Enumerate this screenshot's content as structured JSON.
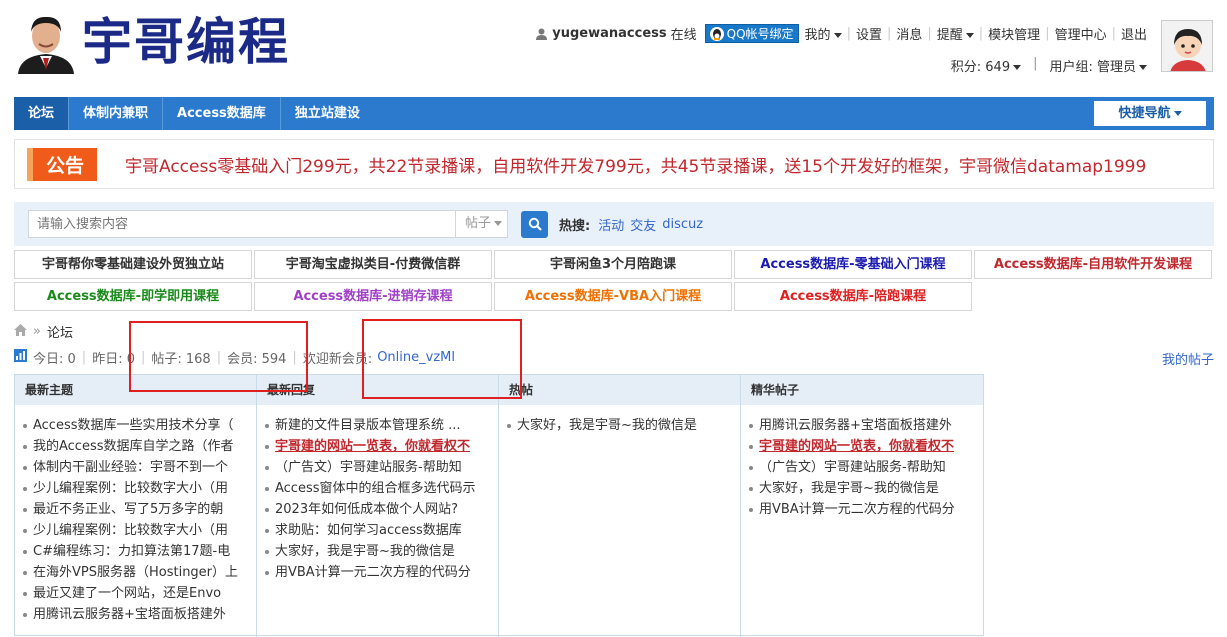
{
  "header": {
    "logo_text": "宇哥编程",
    "username": "yugewanaccess",
    "online": "在线",
    "qq_bind": "QQ帐号绑定",
    "menu": [
      "我的",
      "设置",
      "消息",
      "提醒",
      "模块管理",
      "管理中心",
      "退出"
    ],
    "credits": "积分: 649",
    "usergroup": "用户组: 管理员"
  },
  "nav": {
    "items": [
      "论坛",
      "体制内兼职",
      "Access数据库",
      "独立站建设"
    ],
    "quick_nav": "快捷导航"
  },
  "notice": {
    "badge": "公告",
    "text": "宇哥Access零基础入门299元，共22节录播课，自用软件开发799元，共45节录播课，送15个开发好的框架，宇哥微信datamap1999"
  },
  "search": {
    "placeholder": "请输入搜索内容",
    "type": "帖子",
    "hot_label": "热搜:",
    "hot": [
      "活动",
      "交友",
      "discuz"
    ]
  },
  "links": [
    {
      "label": "宇哥帮你零基础建设外贸独立站",
      "color": "#333333"
    },
    {
      "label": "宇哥淘宝虚拟类目-付费微信群",
      "color": "#333333"
    },
    {
      "label": "宇哥闲鱼3个月陪跑课",
      "color": "#333333"
    },
    {
      "label": "Access数据库-零基础入门课程",
      "color": "#1b1bb0"
    },
    {
      "label": "Access数据库-自用软件开发课程",
      "color": "#c1272d"
    },
    {
      "label": "Access数据库-即学即用课程",
      "color": "#1a8a1a"
    },
    {
      "label": "Access数据库-进销存课程",
      "color": "#a040c8"
    },
    {
      "label": "Access数据库-VBA入门课程",
      "color": "#f07000"
    },
    {
      "label": "Access数据库-陪跑课程",
      "color": "#e02020"
    }
  ],
  "breadcrumb": {
    "sep": "»",
    "current": "论坛"
  },
  "stats": {
    "today": "今日: 0",
    "yesterday": "昨日: 0",
    "posts": "帖子: 168",
    "members": "会员: 594",
    "welcome": "欢迎新会员:",
    "new_member": "Online_vzMl",
    "my_posts": "我的帖子"
  },
  "columns": [
    {
      "title": "最新主题",
      "items": [
        {
          "text": "Access数据库一些实用技术分享（"
        },
        {
          "text": "我的Access数据库自学之路（作者"
        },
        {
          "text": "体制内干副业经验：宇哥不到一个"
        },
        {
          "text": "少儿编程案例：比较数字大小（用"
        },
        {
          "text": "最近不务正业、写了5万多字的朝"
        },
        {
          "text": "少儿编程案例：比较数字大小（用"
        },
        {
          "text": "C#编程练习：力扣算法第17题-电"
        },
        {
          "text": "在海外VPS服务器（Hostinger）上"
        },
        {
          "text": "最近又建了一个网站，还是Envo"
        },
        {
          "text": "用腾讯云服务器+宝塔面板搭建外"
        }
      ]
    },
    {
      "title": "最新回复",
      "items": [
        {
          "text": "新建的文件目录版本管理系统 ..."
        },
        {
          "text": "宇哥建的网站一览表，你就看权不",
          "hl": true
        },
        {
          "text": "（广告文）宇哥建站服务-帮助知"
        },
        {
          "text": "Access窗体中的组合框多选代码示"
        },
        {
          "text": "2023年如何低成本做个人网站?"
        },
        {
          "text": "求助贴：如何学习access数据库"
        },
        {
          "text": "大家好，我是宇哥~我的微信是"
        },
        {
          "text": "用VBA计算一元二次方程的代码分"
        }
      ]
    },
    {
      "title": "热帖",
      "items": [
        {
          "text": "大家好，我是宇哥~我的微信是"
        }
      ]
    },
    {
      "title": "精华帖子",
      "items": [
        {
          "text": "用腾讯云服务器+宝塔面板搭建外"
        },
        {
          "text": "宇哥建的网站一览表，你就看权不",
          "hl": true
        },
        {
          "text": "（广告文）宇哥建站服务-帮助知"
        },
        {
          "text": "大家好，我是宇哥~我的微信是"
        },
        {
          "text": "用VBA计算一元二次方程的代码分"
        }
      ]
    }
  ]
}
